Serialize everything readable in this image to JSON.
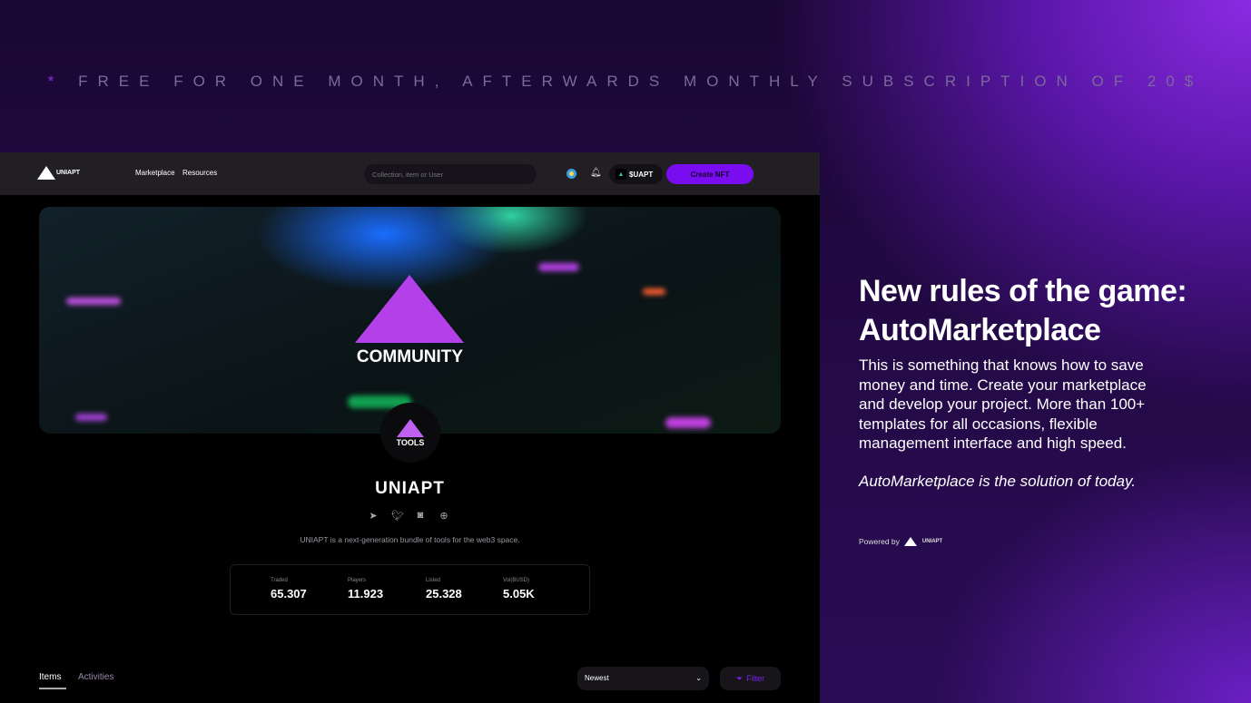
{
  "promo_banner": "FREE FOR ONE MONTH, AFTERWARDS MONTHLY SUBSCRIPTION OF 20$",
  "promo_mark": "*",
  "nav": {
    "logo": "UNIAPT",
    "links": [
      "Marketplace",
      "Resources"
    ],
    "search_placeholder": "Collection, item or User",
    "token": "$UAPT",
    "create": "Create NFT"
  },
  "banner": {
    "text": "COMMUNITY"
  },
  "profile": {
    "avatar_text": "TOOLS",
    "name": "UNIAPT",
    "description": "UNIAPT is a next-generation bundle of tools for the web3 space.",
    "stats": [
      {
        "label": "Traded",
        "value": "65.307"
      },
      {
        "label": "Players",
        "value": "11.923"
      },
      {
        "label": "Listed",
        "value": "25.328"
      },
      {
        "label": "Vol(BUSD)",
        "value": "5.05K"
      }
    ]
  },
  "tabs": [
    "Items",
    "Activities"
  ],
  "sort": "Newest",
  "filter": "Filter",
  "colors": {
    "accent": "#7a0cf0",
    "background": "#1a0733"
  },
  "promo": {
    "headline1": "New rules of the game:",
    "headline2": "AutoMarketplace",
    "body": "This is something that knows how to save money and time. Create your marketplace and develop your project. More than 100+ templates for all occasions, flexible management interface and high speed.",
    "tagline": "AutoMarketplace is the solution of today.",
    "powered": "Powered by",
    "powered_logo": "UNIAPT"
  }
}
